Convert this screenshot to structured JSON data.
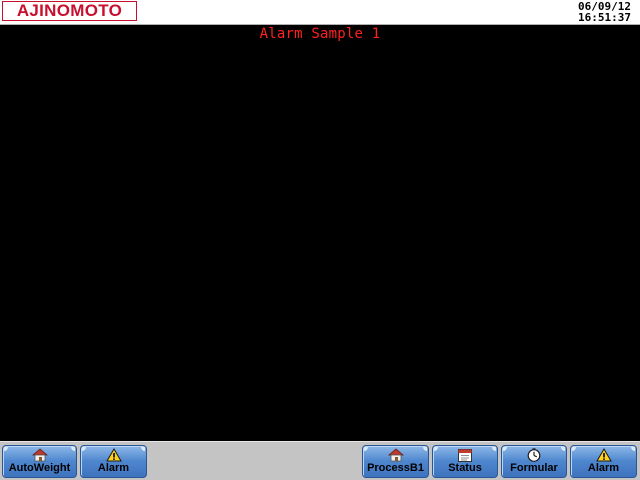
{
  "header": {
    "logo_text": "AJINOMOTO",
    "date": "06/09/12",
    "time": "16:51:37"
  },
  "screen": {
    "title": "Alarm Sample 1"
  },
  "colors": {
    "logo_red": "#c8102e",
    "title_red": "#ff2020",
    "nav_button_blue": "#4f87cf",
    "navbar_gray": "#c4c4c4"
  },
  "navbar": {
    "buttons": [
      {
        "label": "AutoWeight",
        "icon": "house-icon"
      },
      {
        "label": "Alarm",
        "icon": "warning-icon"
      },
      {
        "label": "ProcessB1",
        "icon": "house-icon"
      },
      {
        "label": "Status",
        "icon": "calendar-icon"
      },
      {
        "label": "Formular",
        "icon": "clock-icon"
      },
      {
        "label": "Alarm",
        "icon": "warning-icon"
      }
    ]
  }
}
